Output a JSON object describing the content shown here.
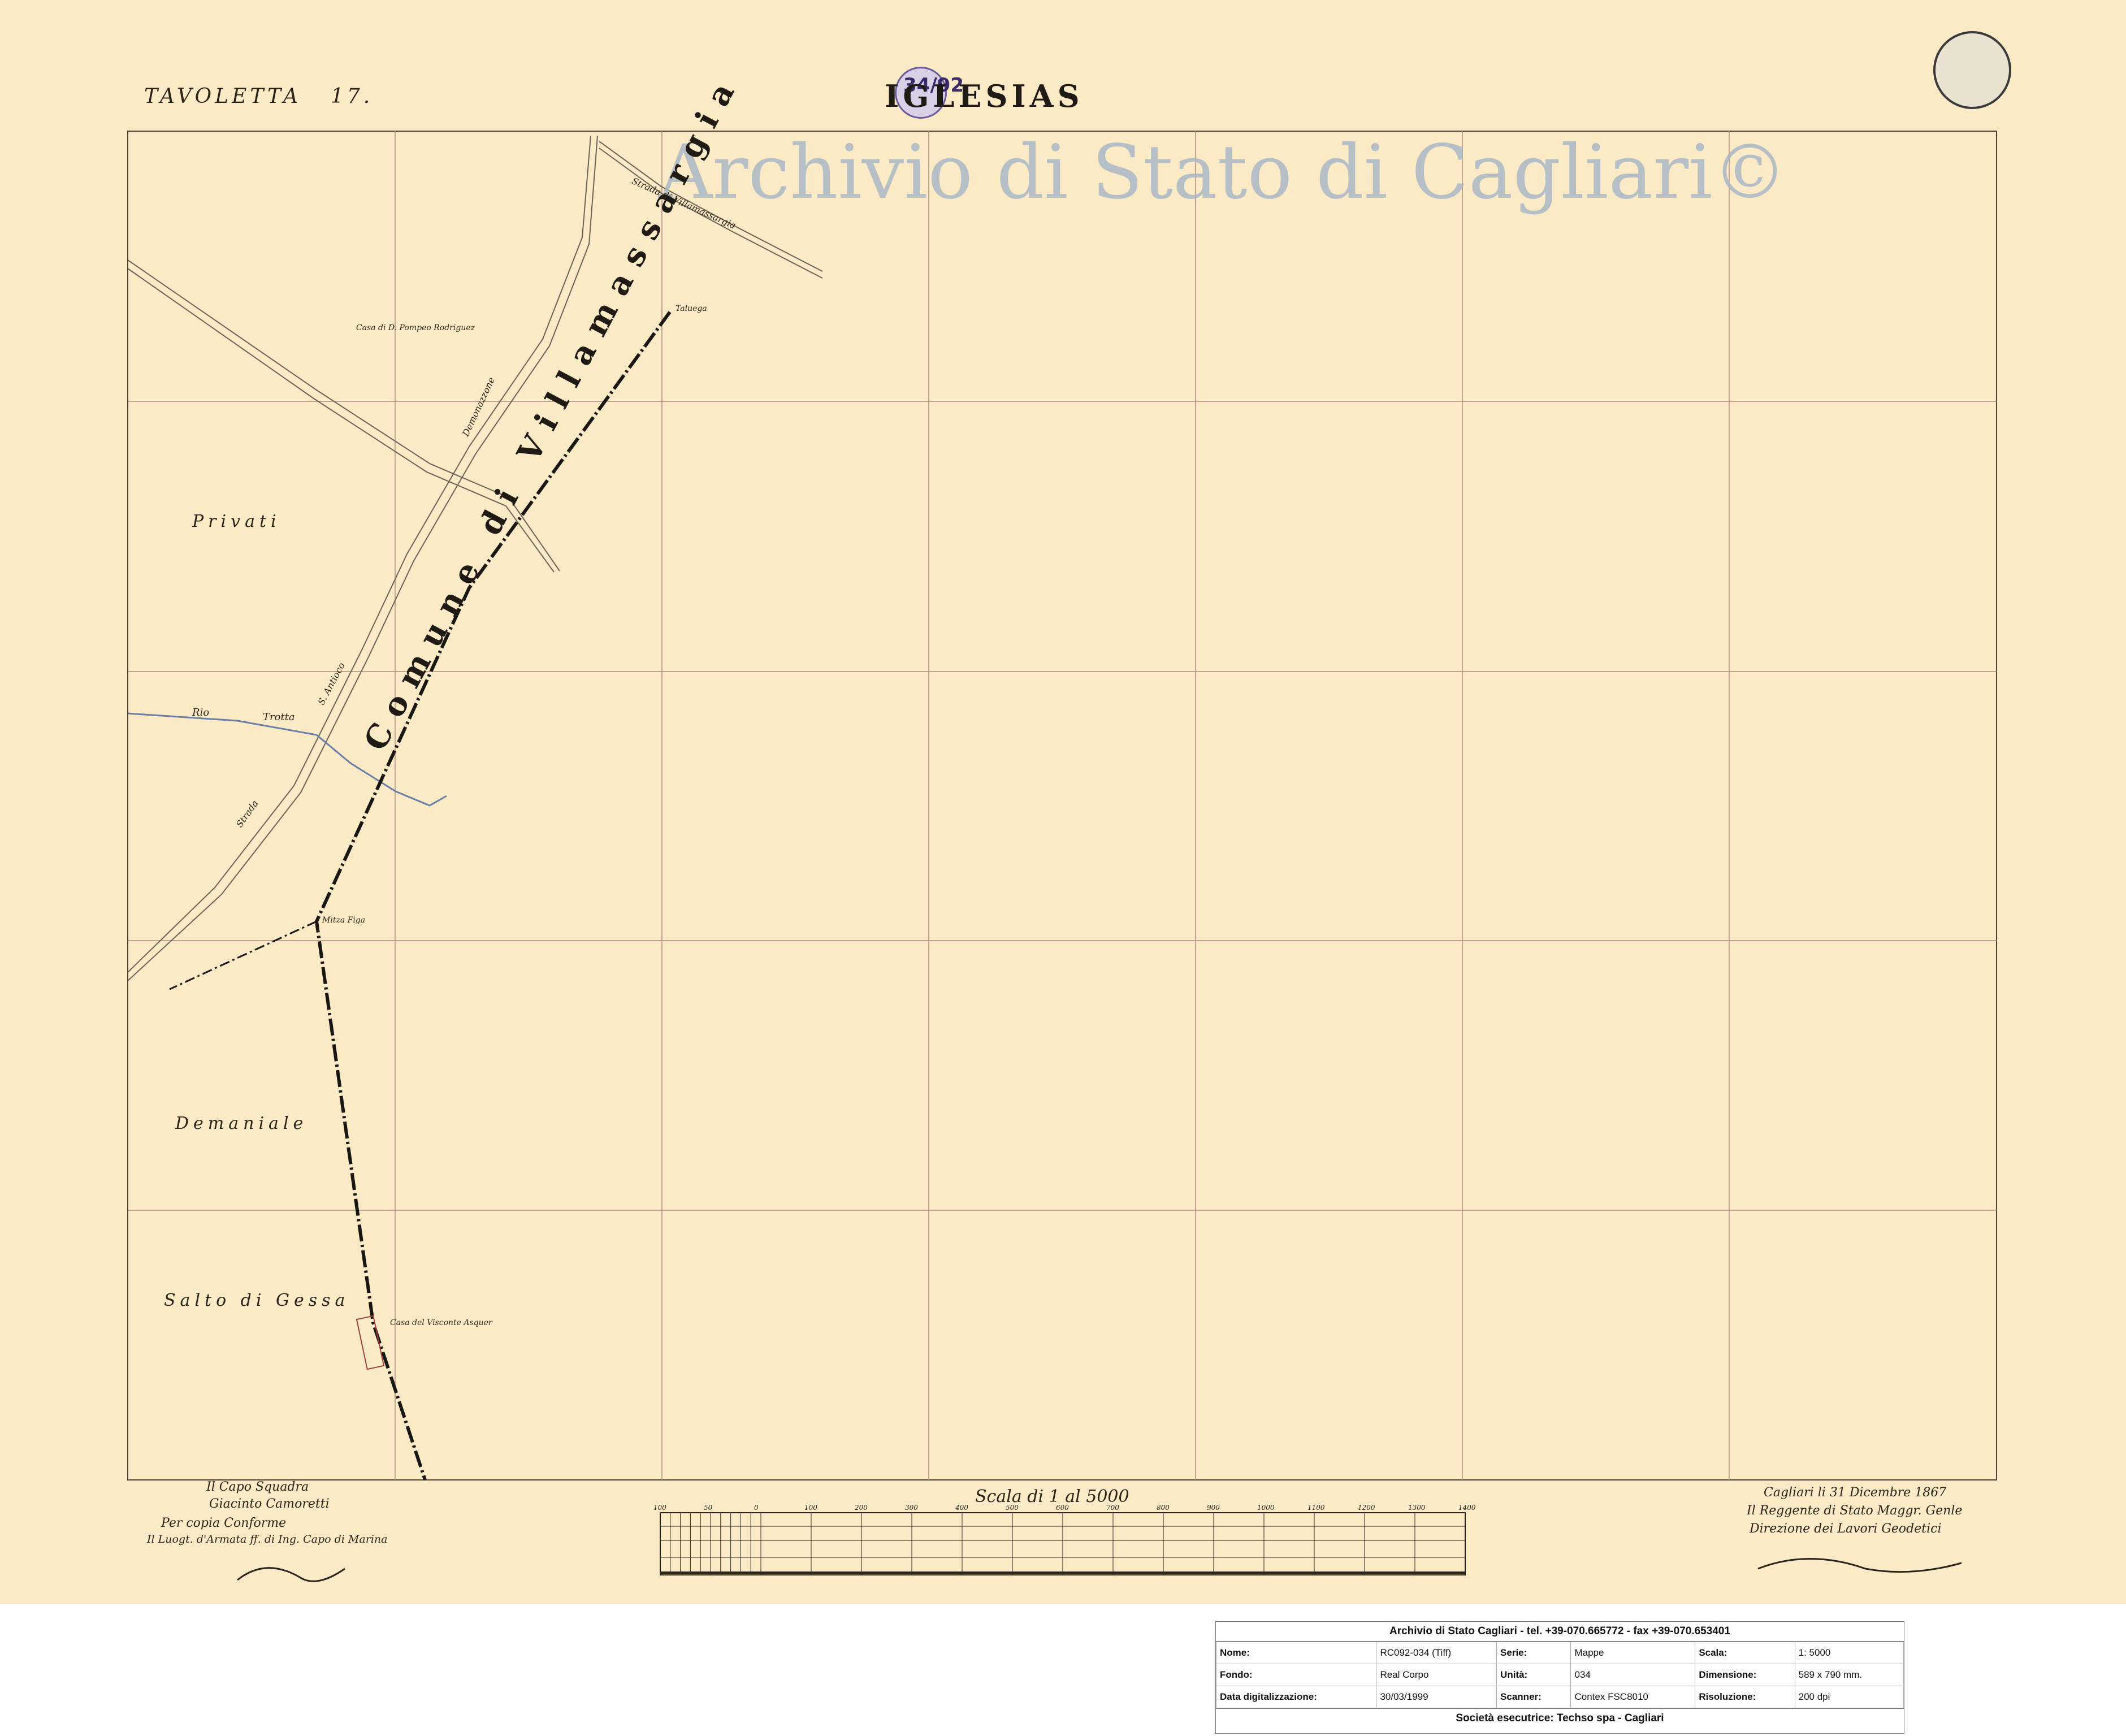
{
  "header": {
    "tavoletta_label": "TAVOLETTA",
    "tavoletta_number": "17.",
    "title": "IGLESIAS",
    "catalog_stamp": "34/92"
  },
  "watermark": "Archivio di Stato di Cagliari©",
  "map_labels": {
    "privati": "Privati",
    "demaniale": "Demaniale",
    "salto": "Salto di Gessa",
    "comune": "Comune di Villamassargia",
    "casa_pompeo": "Casa di D. Pompeo Rodriguez",
    "taluega": "Taluega",
    "mitza": "Mitza Figa",
    "casa_visconte": "Casa del Visconte Asquer",
    "rio": "Rio",
    "trotta": "Trotta",
    "strada_villamassargia": "Strada di Villamassargia",
    "strada": "Strada",
    "s_antioco": "S. Antioco",
    "demonazzone": "Demonazzone"
  },
  "scale": {
    "title": "Scala di 1 al 5000",
    "ticks": [
      "100",
      "50",
      "0",
      "100",
      "200",
      "300",
      "400",
      "500",
      "600",
      "700",
      "800",
      "900",
      "1000",
      "1100",
      "1200",
      "1300",
      "1400"
    ]
  },
  "signatures": {
    "left_line1": "Il Capo Squadra",
    "left_line2": "Giacinto Camoretti",
    "left_line3": "Per copia Conforme",
    "left_line4": "Il Luogt. d'Armata ff. di Ing. Capo di Marina",
    "right_line1": "Cagliari li 31 Dicembre 1867",
    "right_line2": "Il Reggente di Stato Maggr. Genle",
    "right_line3": "Direzione dei Lavori Geodetici"
  },
  "info_box": {
    "header": "Archivio di Stato Cagliari - tel. +39-070.665772 - fax +39-070.653401",
    "rows": [
      [
        "Nome:",
        "RC092-034 (Tiff)",
        "Serie:",
        "Mappe",
        "Scala:",
        "1: 5000"
      ],
      [
        "Fondo:",
        "Real Corpo",
        "Unità:",
        "034",
        "Dimensione:",
        "589 x 790 mm."
      ],
      [
        "Data digitalizzazione:",
        "30/03/1999",
        "Scanner:",
        "Contex FSC8010",
        "Risoluzione:",
        "200 dpi"
      ]
    ],
    "footer": "Società esecutrice: Techso spa - Cagliari"
  },
  "colors": {
    "paper": "#faebc6",
    "grid": "#b38a80",
    "ink": "#2a2418",
    "watermark": "#a9b6c6",
    "river": "#6b7fa6"
  }
}
